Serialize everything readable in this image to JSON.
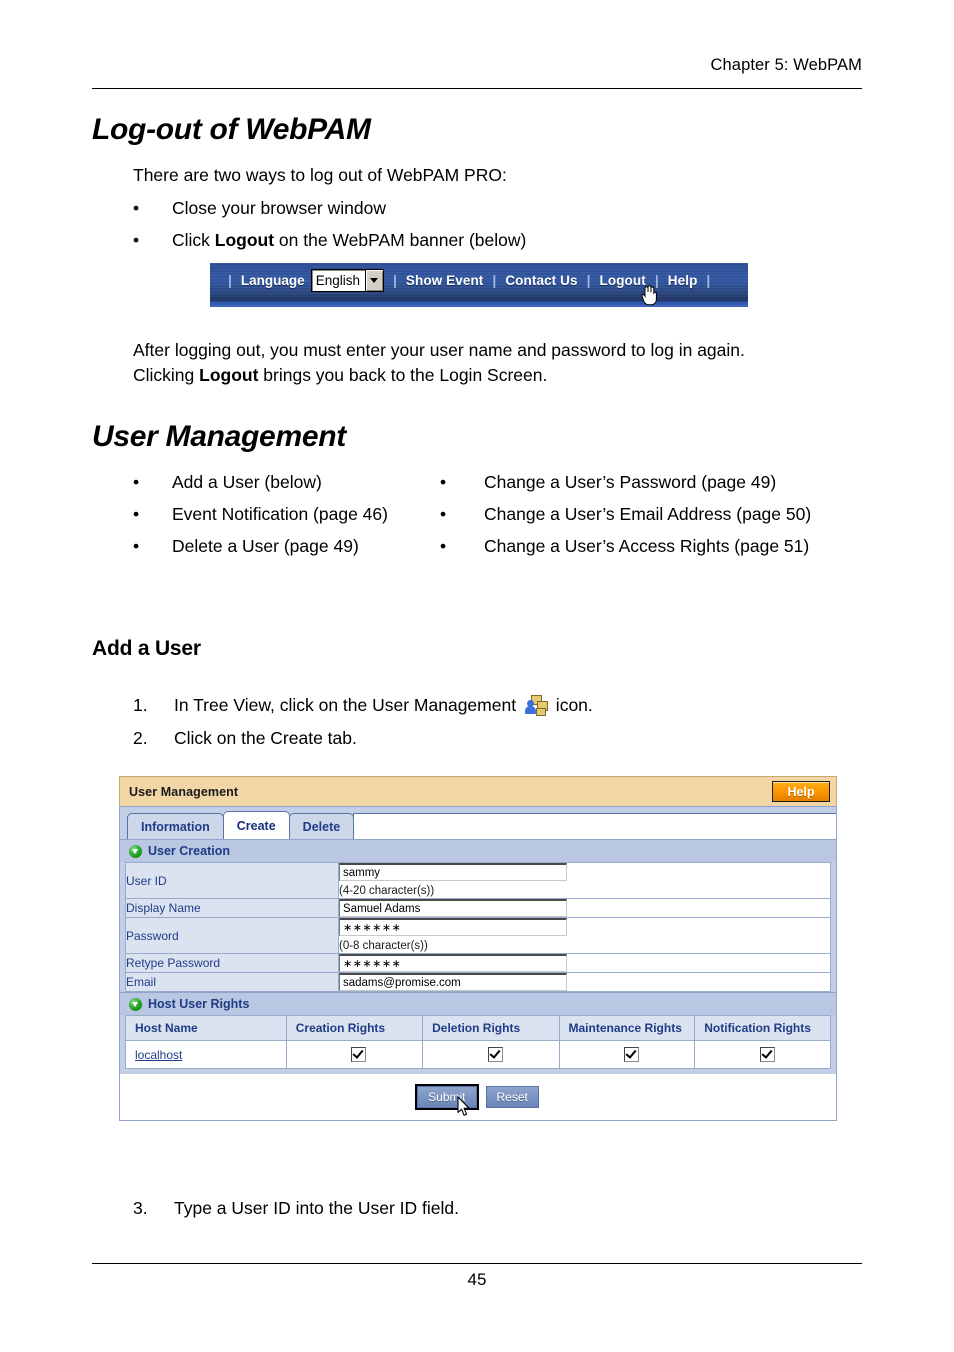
{
  "header": {
    "chapter": "Chapter 5: WebPAM"
  },
  "sections": {
    "logout": {
      "heading": "Log-out of WebPAM",
      "intro": "There are two ways to log out of WebPAM PRO:",
      "bullets": [
        {
          "dot": "•",
          "prefix": "Close your browser window",
          "bold": "",
          "suffix": ""
        },
        {
          "dot": "•",
          "prefix": "Click ",
          "bold": "Logout",
          "suffix": " on the WebPAM banner (below)"
        }
      ],
      "after_para_line1": "After logging out, you must enter your user name and password to log in again.",
      "after_para_pre": "Clicking ",
      "after_para_bold": "Logout",
      "after_para_post": " brings you back to the Login Screen."
    },
    "user_management": {
      "heading": "User Management",
      "left_bullets": [
        {
          "dot": "•",
          "text": "Add a User (below)"
        },
        {
          "dot": "•",
          "text": "Event Notification (page 46)"
        },
        {
          "dot": "•",
          "text": "Delete a User (page 49)"
        }
      ],
      "right_bullets": [
        {
          "dot": "•",
          "text": "Change a User’s Password (page 49)"
        },
        {
          "dot": "•",
          "text": "Change a User’s Email Address (page 50)"
        },
        {
          "dot": "•",
          "text": "Change a User’s Access Rights (page 51)"
        }
      ]
    },
    "add_a_user": {
      "heading": "Add a User",
      "steps": [
        {
          "num": "1.",
          "pre": "In Tree View, click on the User Management ",
          "post": " icon."
        },
        {
          "num": "2.",
          "pre": "Click on the Create tab.",
          "post": ""
        },
        {
          "num": "3.",
          "pre": "Type a User ID into the User ID field.",
          "post": ""
        }
      ]
    }
  },
  "banner": {
    "language_label": "Language",
    "language_value": "English",
    "separator": "|",
    "links": [
      "Show Event",
      "Contact Us",
      "Logout",
      "Help"
    ]
  },
  "app": {
    "title": "User Management",
    "help_label": "Help",
    "tabs": [
      {
        "label": "Information",
        "active": false
      },
      {
        "label": "Create",
        "active": true
      },
      {
        "label": "Delete",
        "active": false
      }
    ],
    "user_creation": {
      "section_label": "User Creation",
      "fields": [
        {
          "label": "User ID",
          "value": "sammy",
          "hint": "(4-20 character(s))",
          "type": "text"
        },
        {
          "label": "Display Name",
          "value": "Samuel Adams",
          "hint": "",
          "type": "text"
        },
        {
          "label": "Password",
          "value": "∗∗∗∗∗∗",
          "hint": "(0-8 character(s))",
          "type": "password"
        },
        {
          "label": "Retype Password",
          "value": "∗∗∗∗∗∗",
          "hint": "",
          "type": "password"
        },
        {
          "label": "Email",
          "value": "sadams@promise.com",
          "hint": "",
          "type": "text"
        }
      ]
    },
    "host_user_rights": {
      "section_label": "Host User Rights",
      "columns": [
        "Host Name",
        "Creation Rights",
        "Deletion Rights",
        "Maintenance Rights",
        "Notification Rights"
      ],
      "rows": [
        {
          "host": "localhost",
          "creation": true,
          "deletion": true,
          "maintenance": true,
          "notification": true
        }
      ]
    },
    "buttons": {
      "submit": "Submit",
      "reset": "Reset"
    }
  },
  "footer": {
    "page_number": "45"
  },
  "colors": {
    "banner_blue": "#2e4e96",
    "titlebar_tan": "#f2d6a6",
    "help_orange": "#fb9200",
    "panel_blue": "#c3cfe6",
    "label_blue": "#dbe2f0",
    "link_blue": "#1f3c86"
  }
}
